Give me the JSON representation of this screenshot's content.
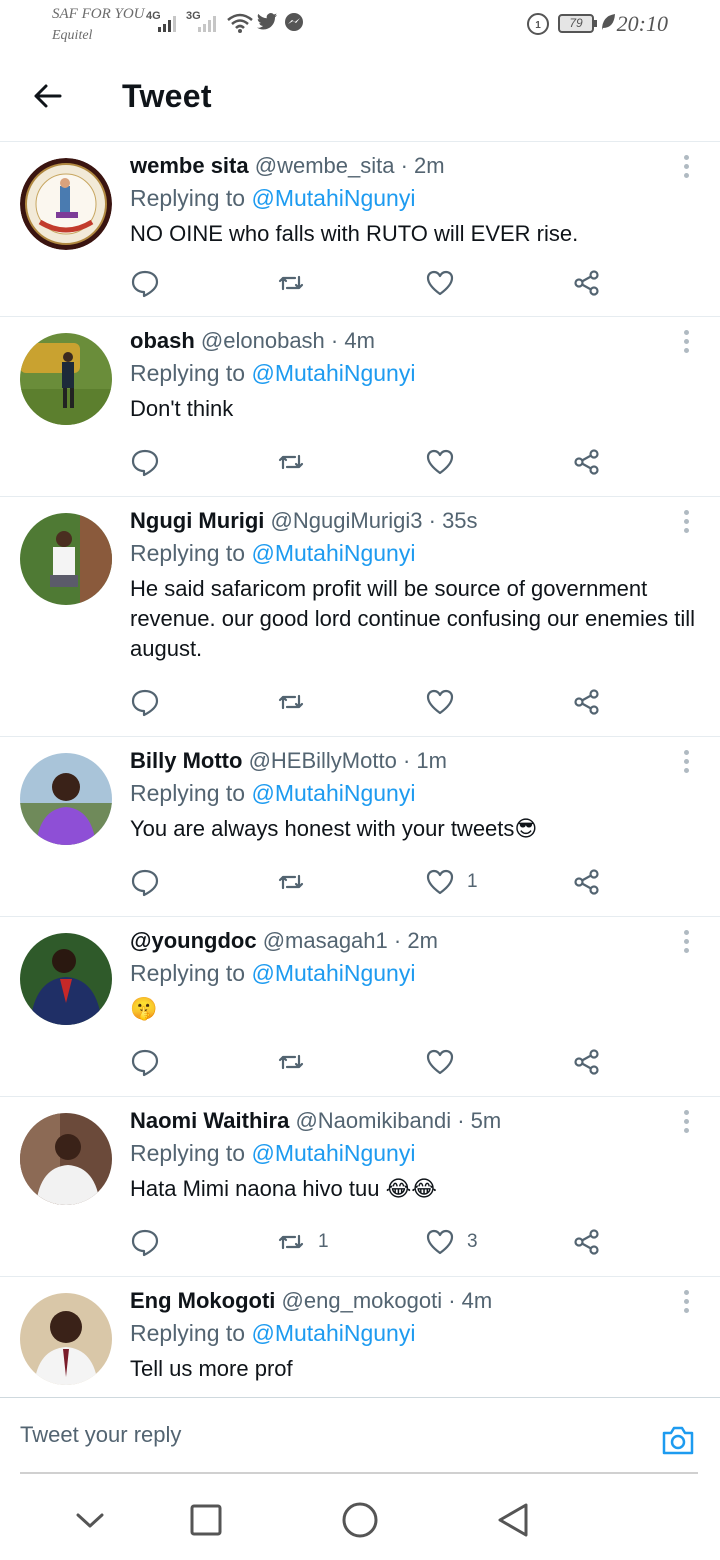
{
  "status_bar": {
    "carrier_primary": "SAF FOR YOU",
    "carrier_secondary": "Equitel",
    "net1": "4G",
    "net2": "3G",
    "battery": "79",
    "time": "20:10"
  },
  "header": {
    "title": "Tweet"
  },
  "tweets": [
    {
      "name": "wembe sita",
      "handle": "@wembe_sita",
      "time": "2m",
      "replying_prefix": "Replying to ",
      "replying_to": "@MutahiNgunyi",
      "text": "NO OINE who falls with RUTO will EVER rise.",
      "retweets": "",
      "likes": ""
    },
    {
      "name": "obash",
      "handle": "@elonobash",
      "time": "4m",
      "replying_prefix": "Replying to ",
      "replying_to": "@MutahiNgunyi",
      "text": "Don't think",
      "retweets": "",
      "likes": ""
    },
    {
      "name": "Ngugi Murigi",
      "handle": "@NgugiMurigi3",
      "time": "35s",
      "replying_prefix": "Replying to ",
      "replying_to": "@MutahiNgunyi",
      "text": "He said safaricom profit will be source of government revenue. our good lord continue confusing our enemies till august.",
      "retweets": "",
      "likes": ""
    },
    {
      "name": "Billy Motto",
      "handle": "@HEBillyMotto",
      "time": "1m",
      "replying_prefix": "Replying to ",
      "replying_to": "@MutahiNgunyi",
      "text": "You are always honest with your tweets😎",
      "retweets": "",
      "likes": "1"
    },
    {
      "name": "@youngdoc",
      "handle": "@masagah1",
      "time": "2m",
      "replying_prefix": "Replying to ",
      "replying_to": "@MutahiNgunyi",
      "text": "🤫",
      "retweets": "",
      "likes": ""
    },
    {
      "name": "Naomi Waithira",
      "handle": "@Naomikibandi",
      "time": "5m",
      "replying_prefix": "Replying to ",
      "replying_to": "@MutahiNgunyi",
      "text": "Hata Mimi naona hivo tuu 😂😂",
      "retweets": "1",
      "likes": "3"
    },
    {
      "name": "Eng Mokogoti",
      "handle": "@eng_mokogoti",
      "time": "4m",
      "replying_prefix": "Replying to ",
      "replying_to": "@MutahiNgunyi",
      "text": "Tell us more prof",
      "retweets": "",
      "likes": ""
    }
  ],
  "reply_bar": {
    "placeholder": "Tweet your reply"
  },
  "colors": {
    "link": "#1d9bf0",
    "muted": "#536471",
    "divider": "#e6ecf0"
  }
}
